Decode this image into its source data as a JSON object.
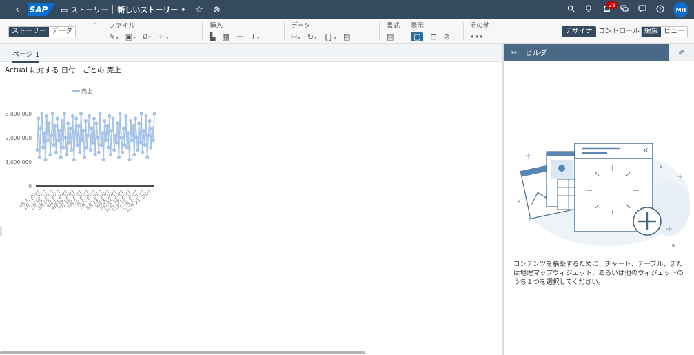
{
  "shell": {
    "logo": "SAP",
    "crumb": "ストーリー",
    "story_title": "新しいストーリー •",
    "notification_count": "28",
    "avatar_initials": "MH"
  },
  "toolbar": {
    "mode_story": "ストーリー",
    "mode_data": "データ",
    "group_file": "ファイル",
    "group_insert": "挿入",
    "group_data": "データ",
    "group_format": "書式",
    "group_view": "表示",
    "group_more": "その他",
    "more_icon": "•••",
    "design_button": "デザイナ",
    "control_button": "コントロール",
    "edit_label": "編集",
    "view_label": "ビュー"
  },
  "page": {
    "tab_label": "ページ 1"
  },
  "chart_data": {
    "type": "line",
    "title": "Actual に対する 日付　ごとの 売上",
    "legend": "売上",
    "legend_position": "top",
    "ylim": [
      0,
      3000000
    ],
    "y_ticks": [
      "3,000,000",
      "2,000,000",
      "1,000,000",
      "0"
    ],
    "x_tick_labels": [
      "1月 1, 2021",
      "1月 22, 2021",
      "2月 15, 2021",
      "3月 10, 2021",
      "4月 1, 2021",
      "4月 26, 2021",
      "5月 18, 2021",
      "6月 9, 2021",
      "7月 1, 2021",
      "7月 22, 2021",
      "8月 13, 2021",
      "9月 3, 2021",
      "9月 24, 2021",
      "10月 18, 2021",
      "11月 10, 2021",
      "12月 1, 2021",
      "12月 23, 2021"
    ],
    "series": [
      {
        "name": "売上",
        "color": "#a7c4e6",
        "values": [
          1500000,
          2800000,
          1200000,
          2400000,
          3000000,
          1600000,
          2200000,
          1100000,
          2900000,
          1900000,
          2600000,
          1300000,
          2100000,
          3000000,
          1700000,
          2500000,
          1400000,
          2800000,
          1900000,
          2300000,
          1200000,
          2700000,
          1600000,
          3000000,
          2000000,
          1300000,
          2600000,
          1800000,
          2400000,
          1500000,
          2900000,
          1100000,
          2200000,
          2800000,
          1700000,
          2500000,
          1400000,
          3000000,
          1900000,
          2300000,
          1200000,
          2700000,
          1600000,
          2100000,
          2900000,
          1500000,
          2400000,
          1800000,
          2800000,
          1300000,
          2600000,
          2000000,
          1400000,
          3000000,
          1700000,
          2200000,
          1100000,
          2700000,
          1900000,
          2500000,
          1600000,
          2900000,
          1300000,
          2300000,
          2800000,
          1500000,
          2100000,
          1800000,
          2600000,
          1200000,
          3000000,
          2000000,
          1400000,
          2400000,
          1700000,
          2900000,
          1600000,
          2200000,
          1100000,
          2700000,
          1900000,
          2500000,
          1300000,
          2800000,
          2000000,
          1500000,
          2600000,
          1800000,
          3000000,
          1400000,
          2300000,
          1700000,
          2900000,
          1200000,
          2100000,
          2700000,
          1600000,
          2400000,
          1900000,
          3000000
        ]
      }
    ]
  },
  "builder": {
    "title": "ビルダ",
    "hint": "コンテンツを構築するために、チャート、テーブル、または地理マップウィジェット、あるいは他のウィジェットのうち１つを選択してください。"
  }
}
